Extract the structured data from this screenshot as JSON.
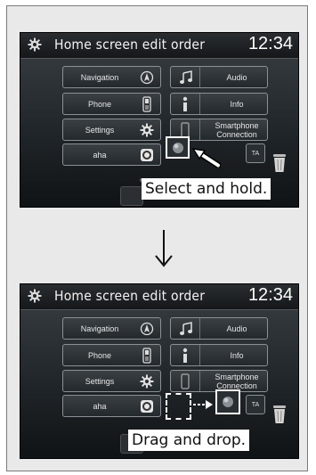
{
  "screens": [
    {
      "title": "Home screen edit order",
      "clock": "12:34",
      "left_tiles": [
        {
          "label": "Navigation",
          "icon": "navigation-compass-icon"
        },
        {
          "label": "Phone",
          "icon": "phone-handset-icon"
        },
        {
          "label": "Settings",
          "icon": "gear-icon"
        },
        {
          "label": "aha",
          "icon": "aha-app-icon"
        }
      ],
      "right_tiles": [
        {
          "label": "Audio",
          "icon": "music-note-icon"
        },
        {
          "label": "Info",
          "icon": "info-icon"
        },
        {
          "label": "Smartphone\nConnection",
          "icon": "smartphone-icon"
        }
      ],
      "ta_label": "TA",
      "caption": "Select and hold."
    },
    {
      "title": "Home screen edit order",
      "clock": "12:34",
      "left_tiles": [
        {
          "label": "Navigation",
          "icon": "navigation-compass-icon"
        },
        {
          "label": "Phone",
          "icon": "phone-handset-icon"
        },
        {
          "label": "Settings",
          "icon": "gear-icon"
        },
        {
          "label": "aha",
          "icon": "aha-app-icon"
        }
      ],
      "right_tiles": [
        {
          "label": "Audio",
          "icon": "music-note-icon"
        },
        {
          "label": "Info",
          "icon": "info-icon"
        },
        {
          "label": "Smartphone\nConnection",
          "icon": "smartphone-icon"
        }
      ],
      "ta_label": "TA",
      "caption": "Drag and drop."
    }
  ],
  "colors": {
    "screen_bg": "#1f2428",
    "tile_border": "#8a9096",
    "caption_bg": "#ffffff"
  }
}
